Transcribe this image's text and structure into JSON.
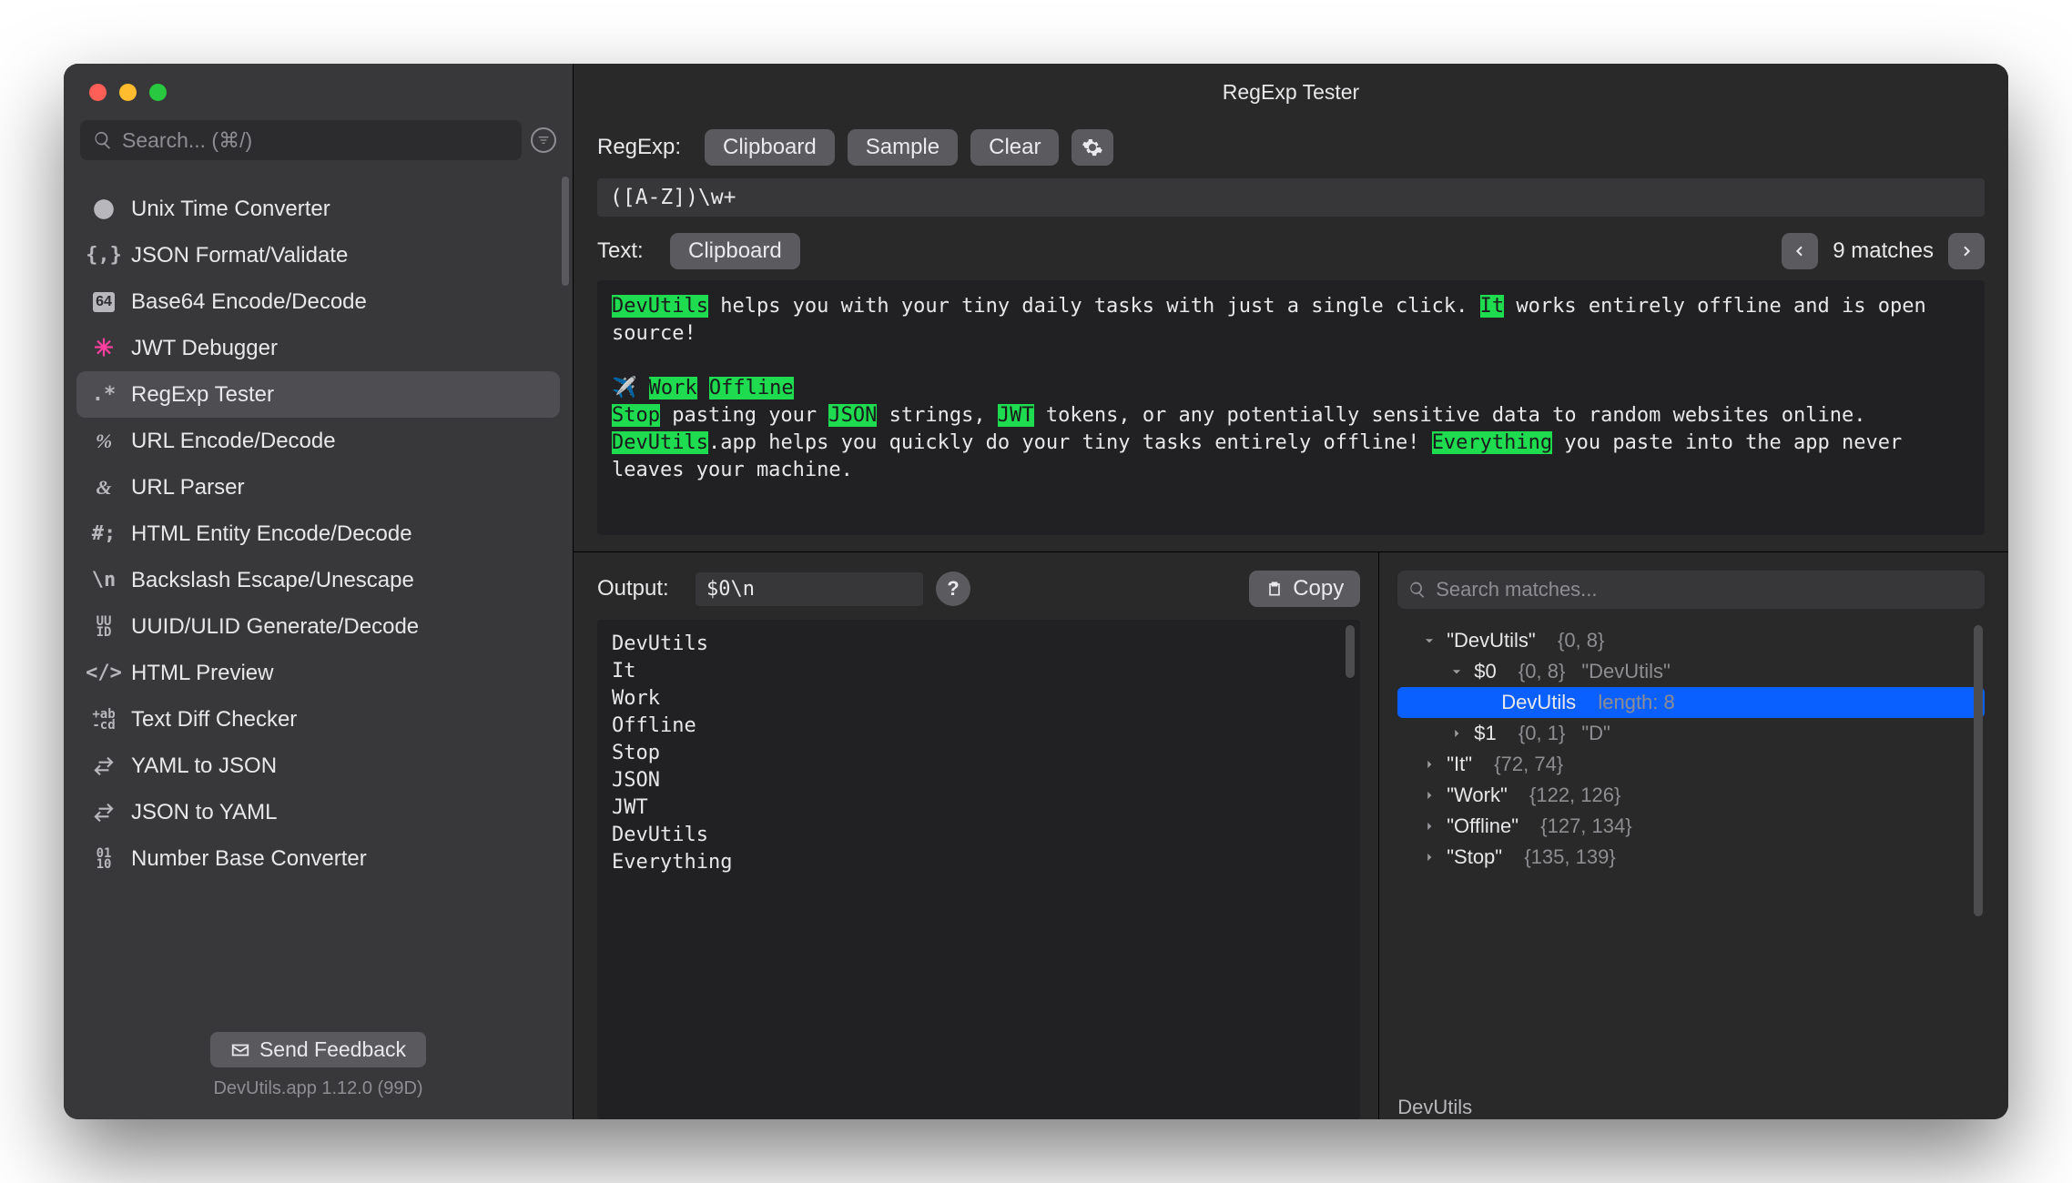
{
  "window": {
    "title": "RegExp Tester"
  },
  "search": {
    "placeholder": "Search... (⌘/)"
  },
  "sidebar": {
    "items": [
      {
        "label": "Unix Time Converter",
        "icon": "clock"
      },
      {
        "label": "JSON Format/Validate",
        "icon": "braces"
      },
      {
        "label": "Base64 Encode/Decode",
        "icon": "b64"
      },
      {
        "label": "JWT Debugger",
        "icon": "jwt"
      },
      {
        "label": "RegExp Tester",
        "icon": "regex",
        "selected": true
      },
      {
        "label": "URL Encode/Decode",
        "icon": "percent"
      },
      {
        "label": "URL Parser",
        "icon": "amp"
      },
      {
        "label": "HTML Entity Encode/Decode",
        "icon": "hash"
      },
      {
        "label": "Backslash Escape/Unescape",
        "icon": "bsn"
      },
      {
        "label": "UUID/ULID Generate/Decode",
        "icon": "uuid"
      },
      {
        "label": "HTML Preview",
        "icon": "tags"
      },
      {
        "label": "Text Diff Checker",
        "icon": "abcd"
      },
      {
        "label": "YAML to JSON",
        "icon": "swap"
      },
      {
        "label": "JSON to YAML",
        "icon": "swap"
      },
      {
        "label": "Number Base Converter",
        "icon": "bits"
      }
    ],
    "feedback": "Send Feedback",
    "version": "DevUtils.app 1.12.0 (99D)"
  },
  "regex": {
    "label": "RegExp:",
    "buttons": {
      "clipboard": "Clipboard",
      "sample": "Sample",
      "clear": "Clear"
    },
    "pattern": "([A-Z])\\w+"
  },
  "text": {
    "label": "Text:",
    "clipboard": "Clipboard",
    "match_count": "9 matches",
    "segments": [
      {
        "t": "DevUtils",
        "h": true
      },
      {
        "t": " helps you with your tiny daily tasks with just a single click. "
      },
      {
        "t": "It",
        "h": true
      },
      {
        "t": " works entirely offline and is open source!\n\n✈️ "
      },
      {
        "t": "Work",
        "h": true
      },
      {
        "t": " "
      },
      {
        "t": "Offline",
        "h": true
      },
      {
        "t": "\n"
      },
      {
        "t": "Stop",
        "h": true
      },
      {
        "t": " pasting your "
      },
      {
        "t": "JSON",
        "h": true
      },
      {
        "t": " strings, "
      },
      {
        "t": "JWT",
        "h": true
      },
      {
        "t": " tokens, or any potentially sensitive data to random websites online. "
      },
      {
        "t": "DevUtils",
        "h": true
      },
      {
        "t": ".app helps you quickly do your tiny tasks entirely offline! "
      },
      {
        "t": "Everything",
        "h": true
      },
      {
        "t": " you paste into the app never leaves your machine."
      }
    ]
  },
  "output": {
    "label": "Output:",
    "format": "$0\\n",
    "copy": "Copy",
    "lines": [
      "DevUtils",
      "It",
      "Work",
      "Offline",
      "Stop",
      "JSON",
      "JWT",
      "DevUtils",
      "Everything"
    ]
  },
  "matches": {
    "search_placeholder": "Search matches...",
    "tree": [
      {
        "depth": 1,
        "chev": "down",
        "key": "\"DevUtils\"",
        "meta": "{0, 8}"
      },
      {
        "depth": 2,
        "chev": "down",
        "key": "$0",
        "meta": "{0, 8}",
        "meta2": "\"DevUtils\""
      },
      {
        "depth": 3,
        "sel": true,
        "key": "DevUtils",
        "meta": "length: 8"
      },
      {
        "depth": 2,
        "chev": "right",
        "key": "$1",
        "meta": "{0, 1}",
        "meta2": "\"D\""
      },
      {
        "depth": 1,
        "chev": "right",
        "key": "\"It\"",
        "meta": "{72, 74}"
      },
      {
        "depth": 1,
        "chev": "right",
        "key": "\"Work\"",
        "meta": "{122, 126}"
      },
      {
        "depth": 1,
        "chev": "right",
        "key": "\"Offline\"",
        "meta": "{127, 134}"
      },
      {
        "depth": 1,
        "chev": "right",
        "key": "\"Stop\"",
        "meta": "{135, 139}"
      }
    ],
    "detail": "DevUtils"
  }
}
